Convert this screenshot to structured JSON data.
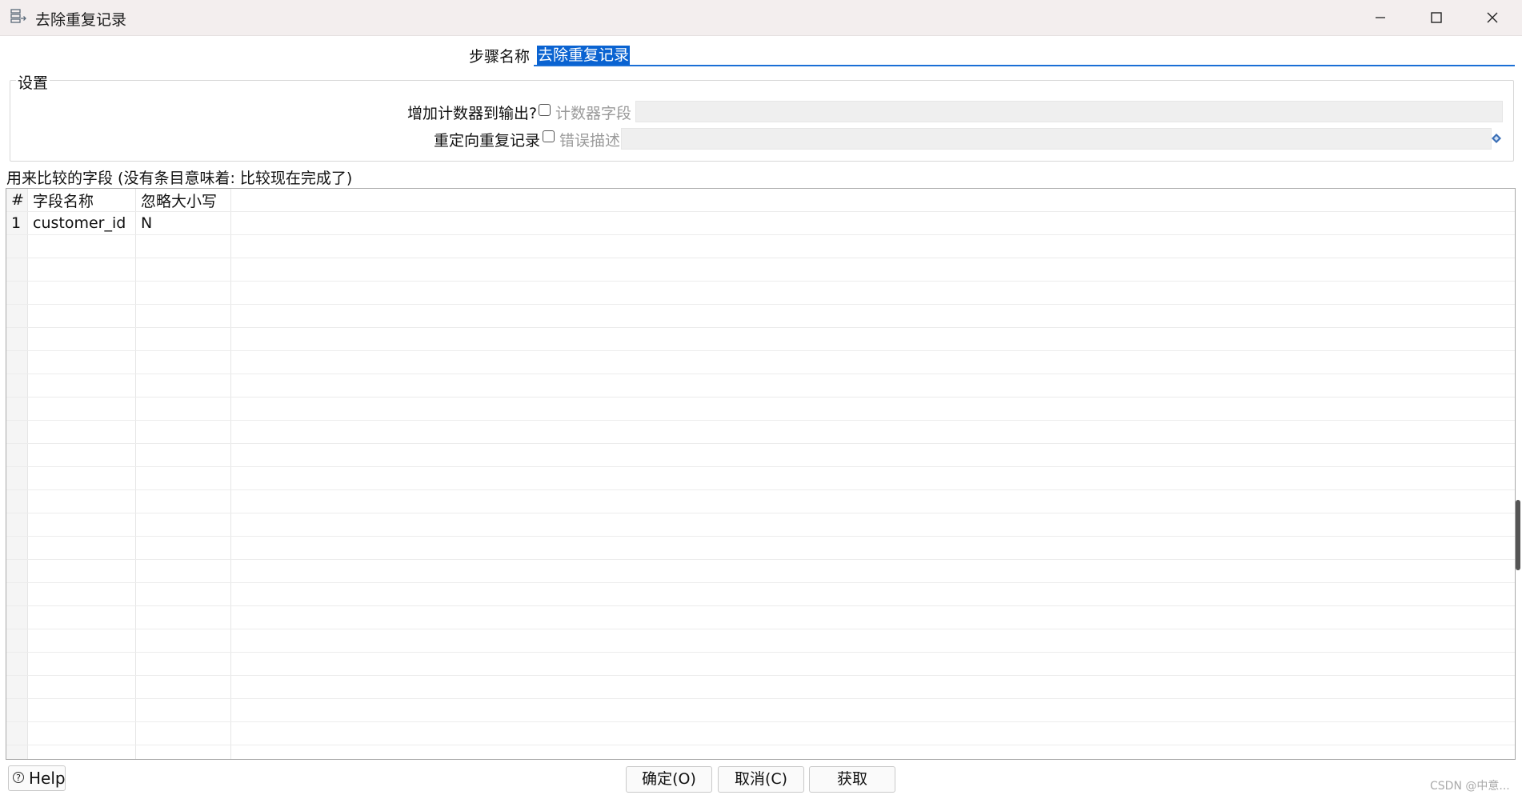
{
  "window": {
    "title": "去除重复记录",
    "icon": "step-dedupe-icon",
    "controls": [
      "minimize-icon",
      "maximize-icon",
      "close-icon"
    ]
  },
  "step": {
    "label": "步骤名称",
    "value": "去除重复记录"
  },
  "settings": {
    "legend": "设置",
    "add_counter": {
      "label": "增加计数器到输出?",
      "checked": false,
      "field_label": "计数器字段",
      "field_value": ""
    },
    "redirect_duplicates": {
      "label": "重定向重复记录",
      "checked": false,
      "field_label": "错误描述",
      "field_value": ""
    }
  },
  "fields_section": {
    "caption": "用来比较的字段 (没有条目意味着: 比较现在完成了)",
    "columns": [
      "#",
      "字段名称",
      "忽略大小写"
    ],
    "rows": [
      {
        "num": "1",
        "field": "customer_id",
        "ignore_case": "N"
      }
    ]
  },
  "buttons": {
    "help": "Help",
    "ok": "确定(O)",
    "cancel": "取消(C)",
    "get": "获取"
  },
  "watermark": "CSDN @中意..."
}
